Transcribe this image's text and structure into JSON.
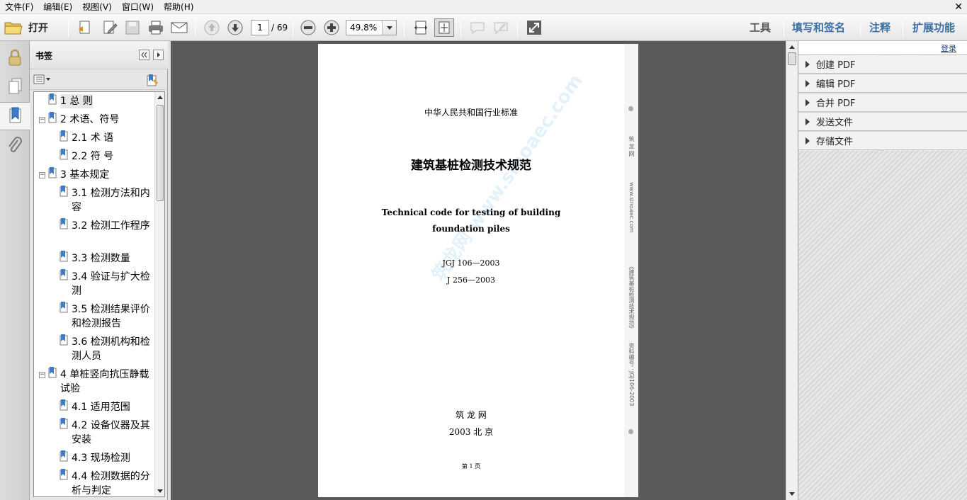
{
  "menu": [
    "文件(F)",
    "编辑(E)",
    "视图(V)",
    "窗口(W)",
    "帮助(H)"
  ],
  "toolbar": {
    "open_label": "打开",
    "page_current": "1",
    "page_total": "/ 69",
    "zoom": "49.8%",
    "tabs": [
      "工具",
      "填写和签名",
      "注释",
      "扩展功能"
    ]
  },
  "bookmarks": {
    "title": "书签",
    "items": [
      {
        "label": "1  总    则",
        "level": 0
      },
      {
        "label": "2  术语、符号",
        "level": 0,
        "expander": "⊟"
      },
      {
        "label": "2.1  术    语",
        "level": 1
      },
      {
        "label": "2.2  符    号",
        "level": 1
      },
      {
        "label": "3  基本规定",
        "level": 0,
        "expander": "⊟"
      },
      {
        "label": "3.1  检测方法和内容",
        "level": 1
      },
      {
        "label": "3.2  检测工作程序",
        "level": 1
      },
      {
        "label": "3.3  检测数量",
        "level": 1
      },
      {
        "label": "3.4  验证与扩大检测",
        "level": 1
      },
      {
        "label": "3.5  检测结果评价和检测报告",
        "level": 1
      },
      {
        "label": "3.6  检测机构和检测人员",
        "level": 1
      },
      {
        "label": "4  单桩竖向抗压静载试验",
        "level": 0,
        "expander": "⊟"
      },
      {
        "label": "4.1  适用范围",
        "level": 1
      },
      {
        "label": "4.2  设备仪器及其安装",
        "level": 1
      },
      {
        "label": "4.3  现场检测",
        "level": 1
      },
      {
        "label": "4.4  检测数据的分析与判定",
        "level": 1
      }
    ]
  },
  "document": {
    "header": "中华人民共和国行业标准",
    "title_cn": "建筑基桩检测技术规范",
    "title_en_1": "Technical code for testing of building",
    "title_en_2": "foundation piles",
    "code_1": "JGJ  106—2003",
    "code_2": "J  256—2003",
    "publisher": "筑  龙  网",
    "place": "2003  北  京",
    "page_no": "第 1 页",
    "side_1": "筑 龙 网",
    "side_2": "www.sinoaec.com",
    "side_3": "《建筑基桩检测技术规范》",
    "side_4": "资料编号：JGJ106-2003",
    "watermark": "筑龙网 www.sinoaec.com"
  },
  "tasks": {
    "login": "登录",
    "items": [
      "创建 PDF",
      "编辑 PDF",
      "合并 PDF",
      "发送文件",
      "存储文件"
    ]
  }
}
